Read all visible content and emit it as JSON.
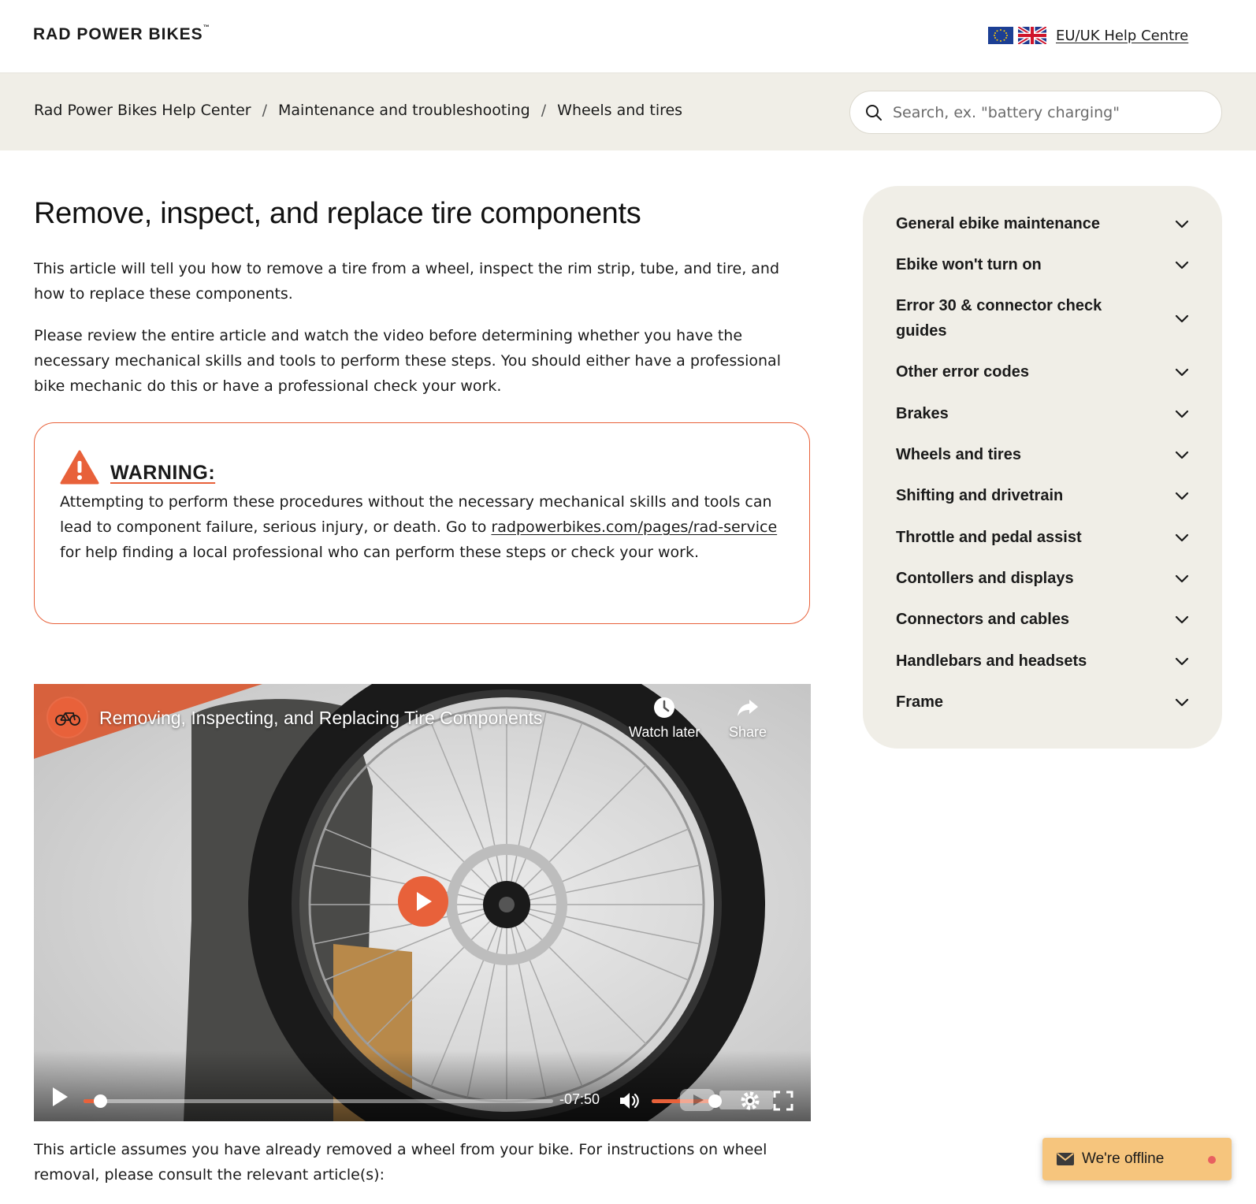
{
  "header": {
    "logo_text": "RAD POWER BIKES",
    "logo_tm": "™",
    "region_link": "EU/UK Help Centre"
  },
  "breadcrumb": {
    "items": [
      "Rad Power Bikes Help Center",
      "Maintenance and troubleshooting",
      "Wheels and tires"
    ],
    "separator": "/"
  },
  "search": {
    "placeholder": "Search, ex. \"battery charging\""
  },
  "article": {
    "title": "Remove, inspect, and replace tire components",
    "intro": "This article will tell you how to remove a tire from a wheel, inspect the rim strip, tube, and tire, and how to replace these components.",
    "review": "Please review the entire article and watch the video before determining whether you have the necessary mechanical skills and tools to perform these steps. You should either have a professional bike mechanic do this or have a professional check your work.",
    "warning": {
      "title": "WARNING:",
      "text_before": "Attempting to perform these procedures without the necessary mechanical skills and tools can lead to component failure, serious injury, or death. Go to ",
      "link": "radpowerbikes.com/pages/rad-service",
      "text_after": " for help finding a local professional who can perform these steps or check your work."
    },
    "after_video": "This article assumes you have already removed a wheel from your bike. For instructions on wheel removal, please consult the relevant article(s):"
  },
  "video": {
    "title": "Removing, Inspecting, and Replacing Tire Components",
    "watch_later": "Watch later",
    "share": "Share",
    "time_remaining": "-07:50",
    "progress_fraction": 0.035,
    "volume_fraction": 0.98
  },
  "sidebar": {
    "items": [
      {
        "label": "General ebike maintenance"
      },
      {
        "label": "Ebike won't turn on"
      },
      {
        "label": "Error 30 & connector check guides"
      },
      {
        "label": "Other error codes"
      },
      {
        "label": "Brakes"
      },
      {
        "label": "Wheels and tires"
      },
      {
        "label": "Shifting and drivetrain"
      },
      {
        "label": "Throttle and pedal assist"
      },
      {
        "label": "Contollers and displays"
      },
      {
        "label": "Connectors and cables"
      },
      {
        "label": "Handlebars and headsets"
      },
      {
        "label": "Frame"
      }
    ]
  },
  "chat": {
    "label": "We're offline"
  },
  "colors": {
    "accent": "#e8613a",
    "beige": "#f0eee7",
    "chat": "#f6c57d"
  }
}
